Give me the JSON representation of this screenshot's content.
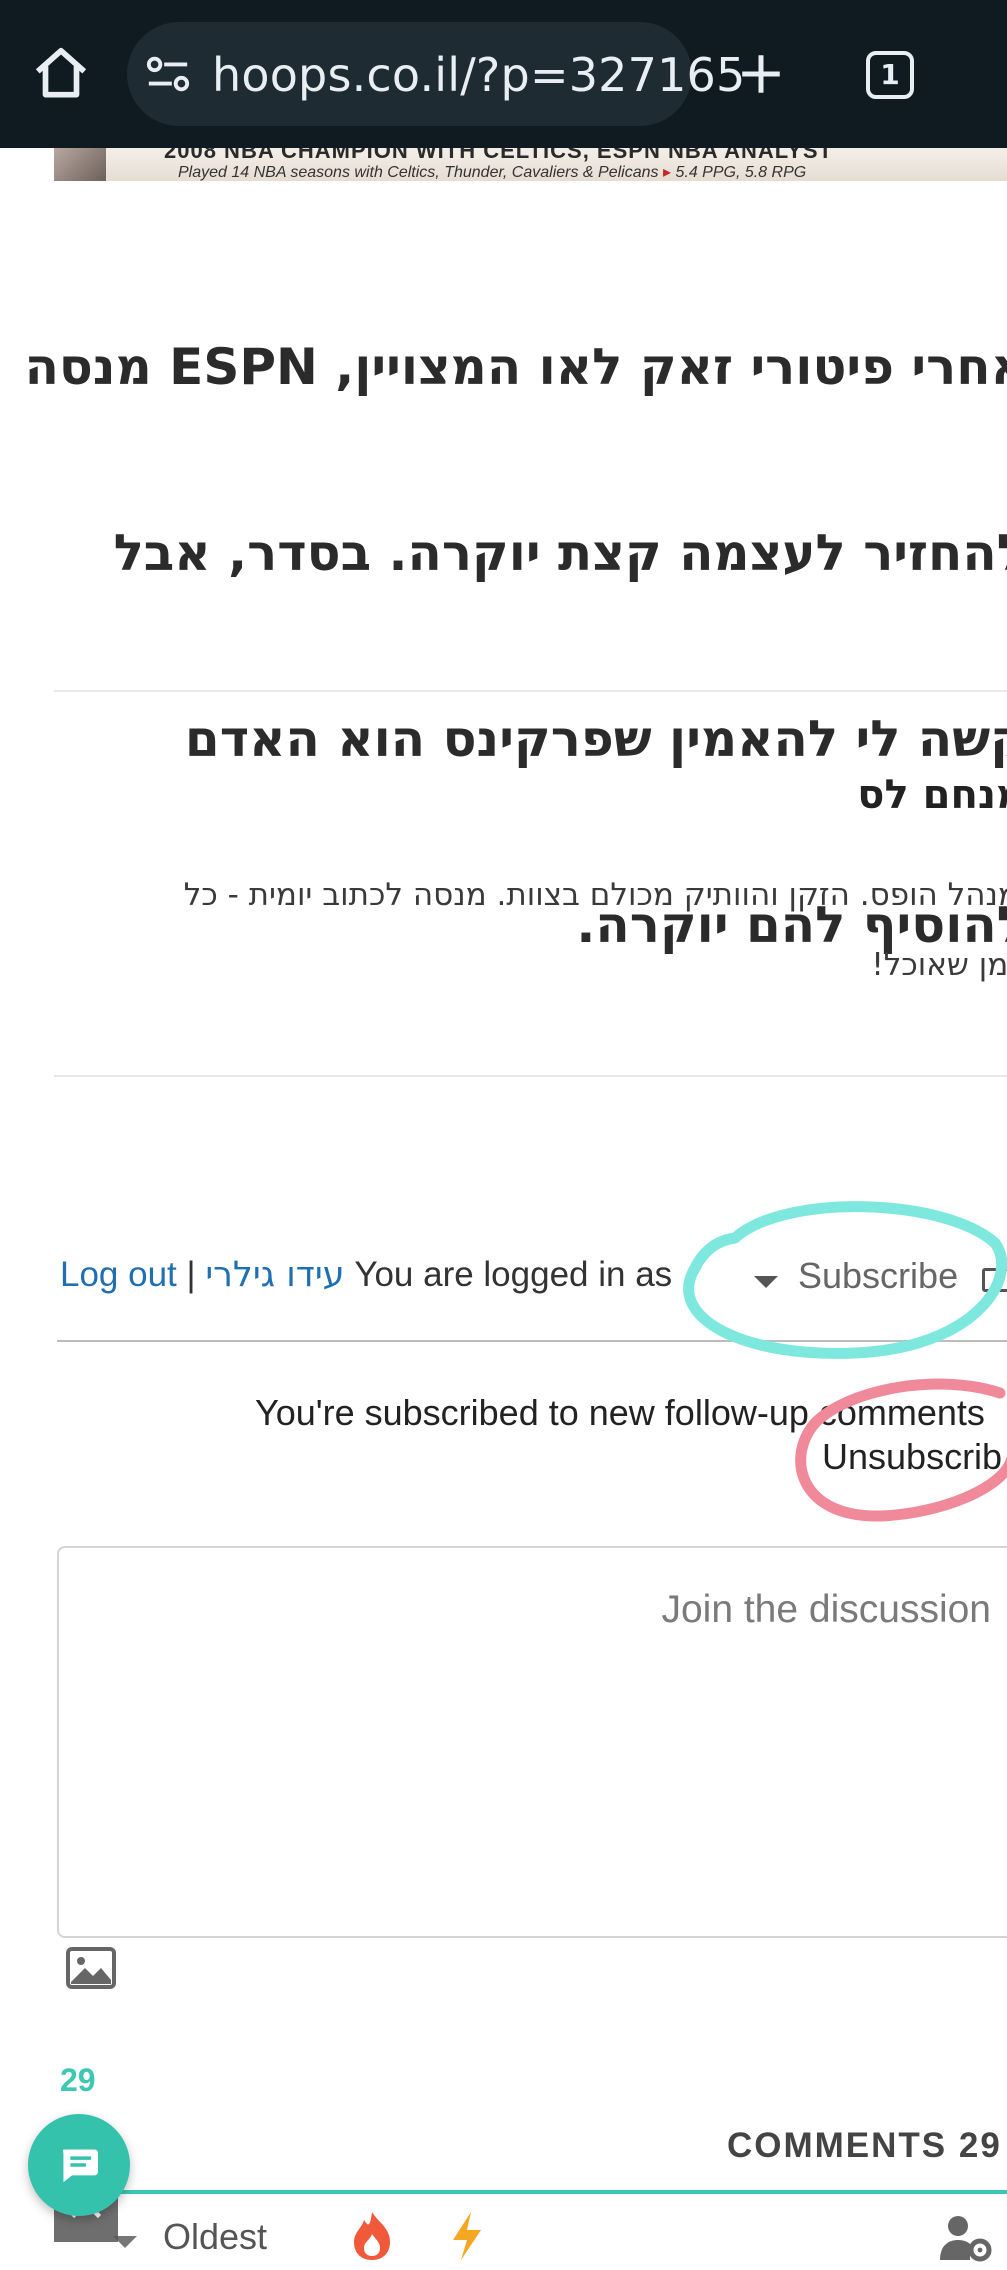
{
  "browser": {
    "url": "hoops.co.il/?p=327165",
    "tab_count": "1"
  },
  "banner": {
    "headline": "2008 NBA CHAMPION WITH CELTICS, ESPN NBA ANALYST",
    "subline": "Played 14 NBA seasons with Celtics, Thunder, Cavaliers & Pelicans",
    "stats": "5.4 PPG, 5.8 RPG"
  },
  "article": {
    "lines": [
      "אחרי פיטורי זאק לאו המצויין, ESPN מנסה",
      "להחזיר לעצמה קצת יוקרה. בסדר, אבל",
      "קשה לי להאמין שפרקינס הוא האדם",
      "להוסיף להם יוקרה."
    ]
  },
  "author": {
    "name": "מנחם לס",
    "bio_lines": [
      "מנהל הופס. הזקן והוותיק מכולם בצוות. מנסה לכתוב יומית - כל",
      "זמן שאוכל!"
    ]
  },
  "comments": {
    "logout_label": "Log out",
    "separator": "|",
    "username": "עידו גילרי",
    "logged_in_text": "You are logged in as",
    "subscribe_label": "Subscribe",
    "subscribed_notice": "You're subscribed to new follow-up comments",
    "unsubscribe_label": "Unsubscrib",
    "placeholder": "Join the discussion",
    "count_badge": "29",
    "heading": "COMMENTS 29",
    "sort_label": "Oldest"
  },
  "colors": {
    "accent": "#3ec7b3",
    "link": "#1f6fb2",
    "annotation_cyan": "#7ee8df",
    "annotation_red": "#f08a9a"
  },
  "icons": {
    "home": "home-icon",
    "site_info": "tune-icon",
    "new_tab": "plus-icon",
    "tabs": "tab-switcher-icon",
    "mail": "mail-icon",
    "image": "image-icon",
    "hot": "flame-icon",
    "trending": "bolt-icon",
    "user_settings": "user-gear-icon",
    "chat": "chat-icon",
    "scroll_top": "chevron-up-icon"
  }
}
